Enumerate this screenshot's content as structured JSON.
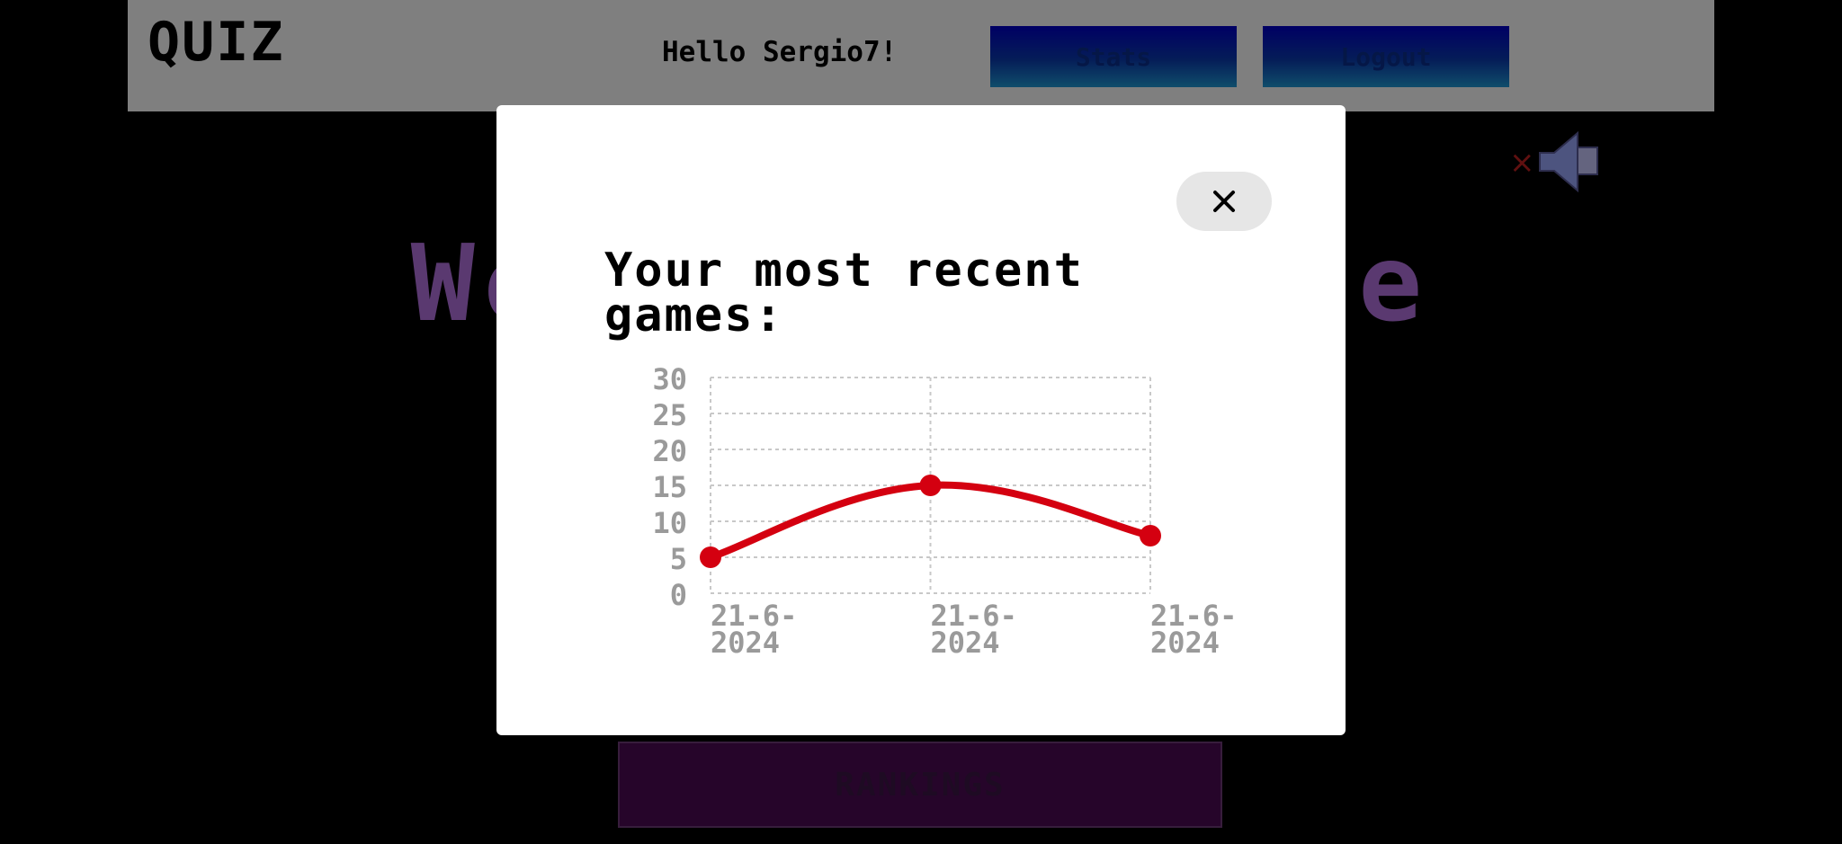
{
  "navbar": {
    "brand": "QUIZ",
    "greeting": "Hello Sergio7!",
    "stats_label": "Stats",
    "logout_label": "Logout"
  },
  "home": {
    "welcome_text": "Welcome to the",
    "rankings_label": "RANKINGS",
    "sound_icon": "speaker-muted-icon"
  },
  "modal": {
    "close_label": "×",
    "title": "Your most recent games:"
  },
  "colors": {
    "line": "#d40010",
    "grid": "#c8c8c8",
    "tick": "#9a9a9a"
  },
  "chart_data": {
    "type": "line",
    "title": "",
    "xlabel": "",
    "ylabel": "",
    "categories": [
      "21-6-2024",
      "21-6-2024",
      "21-6-2024"
    ],
    "series": [
      {
        "values": [
          5,
          15,
          8
        ]
      }
    ],
    "ylim": [
      0,
      30
    ],
    "yticks": [
      0,
      5,
      10,
      15,
      20,
      25,
      30
    ],
    "grid": true,
    "legend": "none"
  }
}
